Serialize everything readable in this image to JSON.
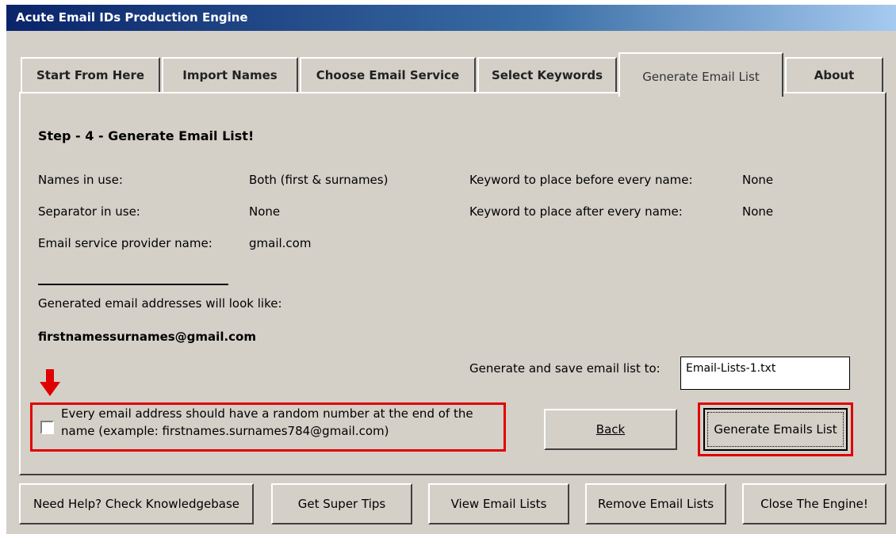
{
  "window": {
    "title": "Acute Email IDs Production Engine"
  },
  "tabs": [
    {
      "label": "Start From Here"
    },
    {
      "label": "Import Names"
    },
    {
      "label": "Choose Email Service"
    },
    {
      "label": "Select Keywords"
    },
    {
      "label": "Generate Email List",
      "active": true
    },
    {
      "label": "About"
    }
  ],
  "panel": {
    "heading": "Step - 4 - Generate Email List!",
    "names_label": "Names in use:",
    "names_value": "Both (first & surnames)",
    "separator_label": "Separator in use:",
    "separator_value": "None",
    "provider_label": "Email service provider name:",
    "provider_value": "gmail.com",
    "kw_before_label": "Keyword to place before every name:",
    "kw_before_value": "None",
    "kw_after_label": "Keyword to place after every name:",
    "kw_after_value": "None",
    "preview_label": "Generated email addresses will look like:",
    "preview_value": "firstnamessurnames@gmail.com",
    "save_label": "Generate and save email list to:",
    "save_value": "Email-Lists-1.txt",
    "random_line1": "Every email address should have a random number at the end of the",
    "random_line2": "name (example: firstnames.surnames784@gmail.com)",
    "random_checked": false,
    "back_button": "Back",
    "generate_button": "Generate Emails List"
  },
  "bottom_buttons": [
    {
      "label": "Need Help? Check Knowledgebase"
    },
    {
      "label": "Get Super Tips"
    },
    {
      "label": "View Email Lists"
    },
    {
      "label": "Remove Email Lists"
    },
    {
      "label": "Close The Engine!"
    }
  ],
  "colors": {
    "highlight": "#e00000",
    "titlebar": "#0a246a",
    "face": "#d4d0c8"
  }
}
